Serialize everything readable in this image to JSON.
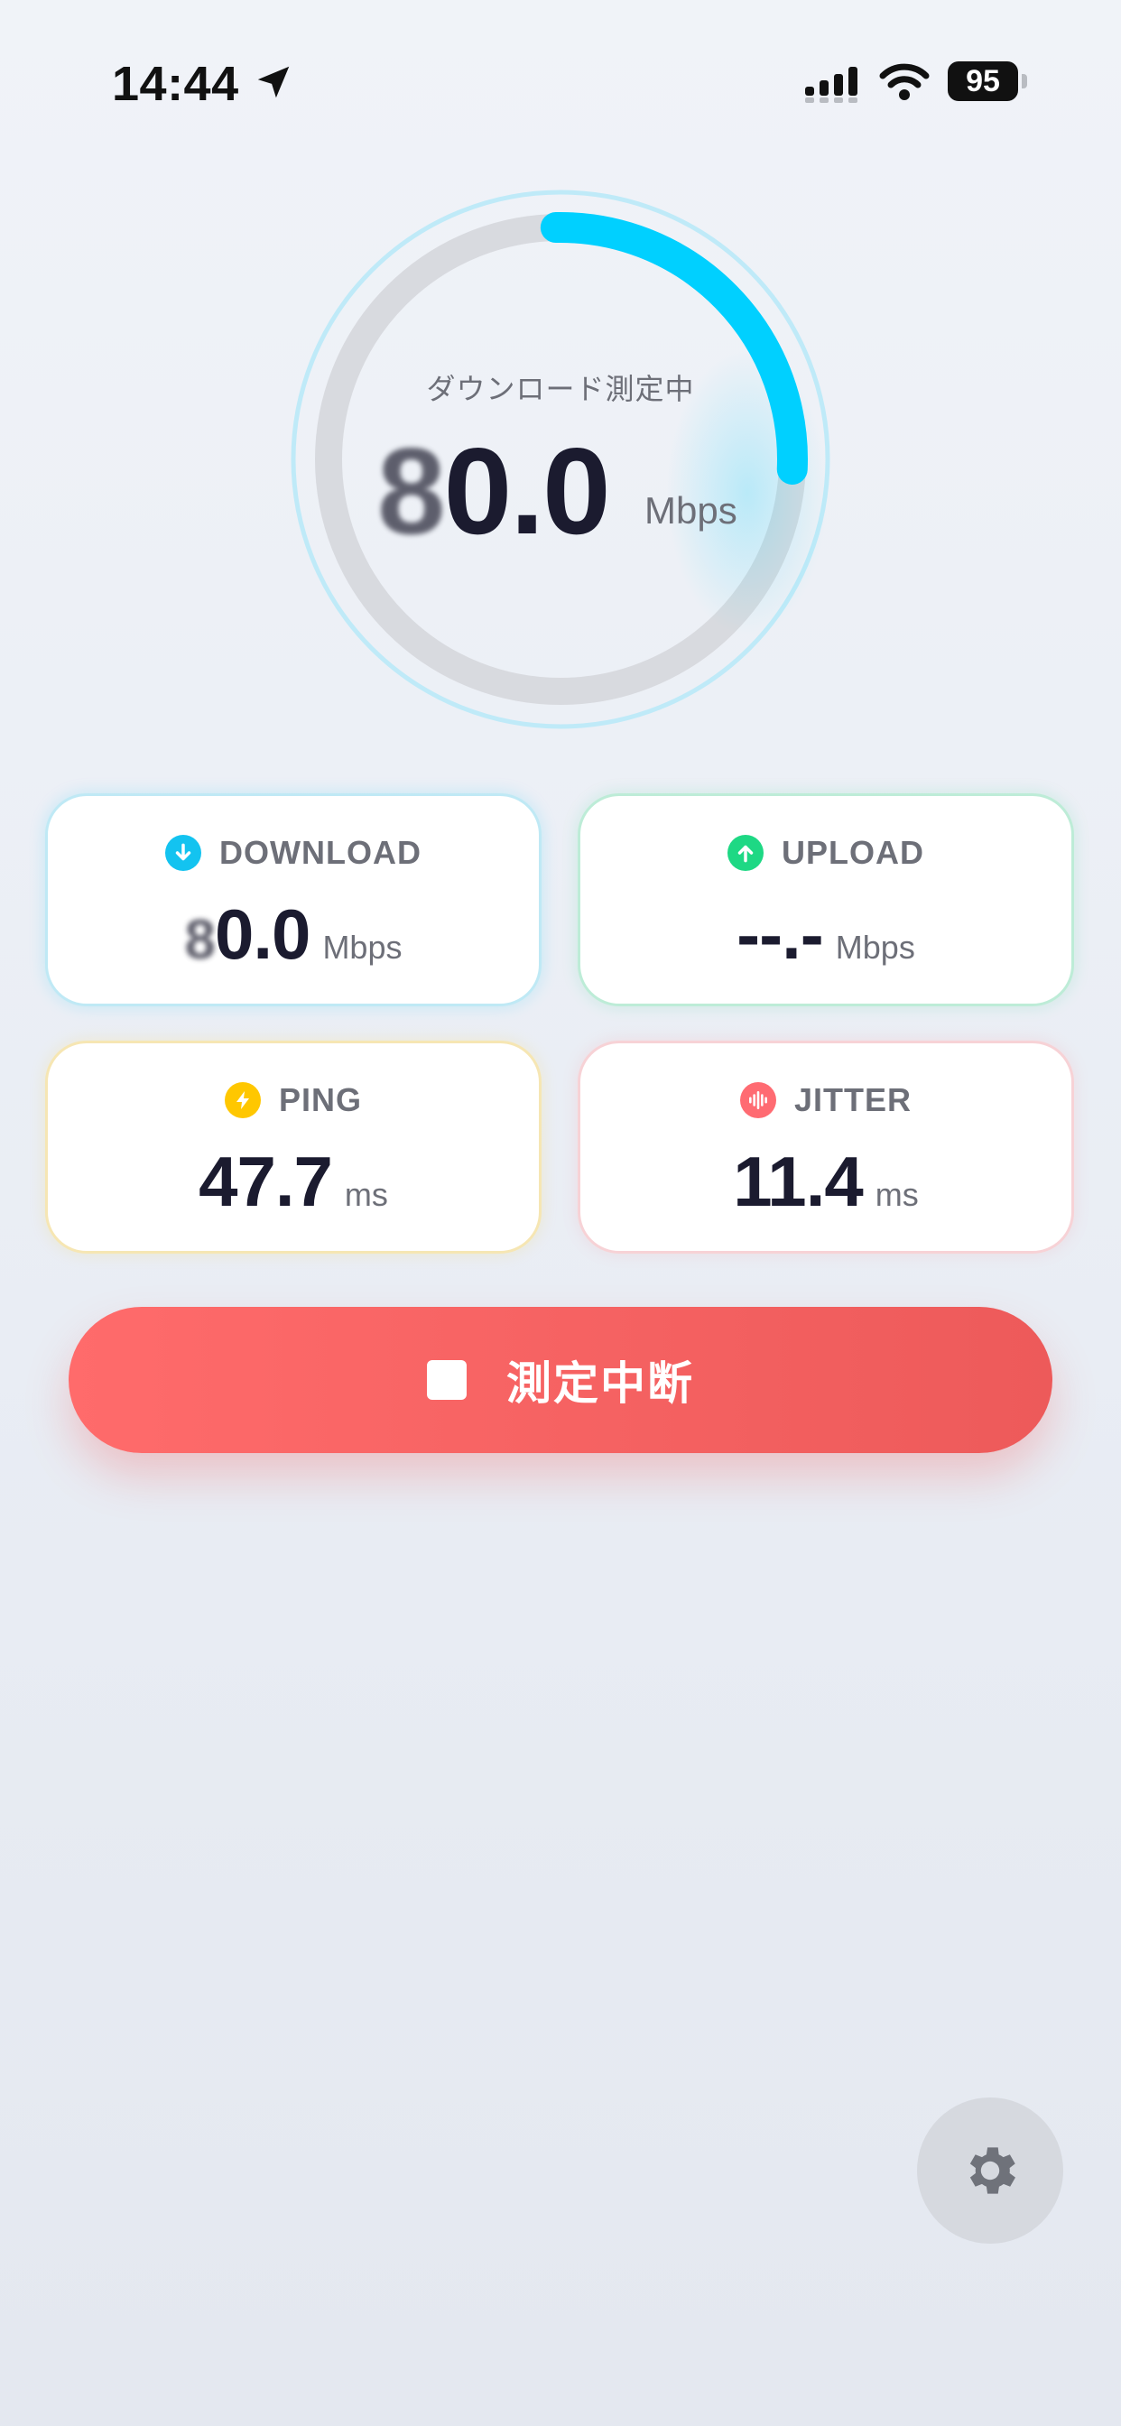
{
  "status_bar": {
    "time": "14:44",
    "battery": "95"
  },
  "gauge": {
    "label": "ダウンロード測定中",
    "value_blurred_digit": "8",
    "value_rest": "0.0",
    "unit": "Mbps",
    "progress_fraction": 0.26,
    "colors": {
      "arc": "#00d0ff",
      "track": "#d8dadf",
      "ring": "#bfeaf8"
    }
  },
  "cards": {
    "download": {
      "title": "DOWNLOAD",
      "value_blurred_digit": "8",
      "value_rest": "0.0",
      "unit": "Mbps",
      "icon": "arrow-down-icon",
      "color": "#13c3f0"
    },
    "upload": {
      "title": "UPLOAD",
      "value": "--.-",
      "unit": "Mbps",
      "icon": "arrow-up-icon",
      "color": "#1ed884"
    },
    "ping": {
      "title": "PING",
      "value": "47.7",
      "unit": "ms",
      "icon": "bolt-icon",
      "color": "#ffc700"
    },
    "jitter": {
      "title": "JITTER",
      "value": "11.4",
      "unit": "ms",
      "icon": "waveform-icon",
      "color": "#ff6b72"
    }
  },
  "stop_button": {
    "label": "測定中断",
    "color": "#ff6b6b"
  },
  "settings": {
    "icon": "gear-icon"
  }
}
